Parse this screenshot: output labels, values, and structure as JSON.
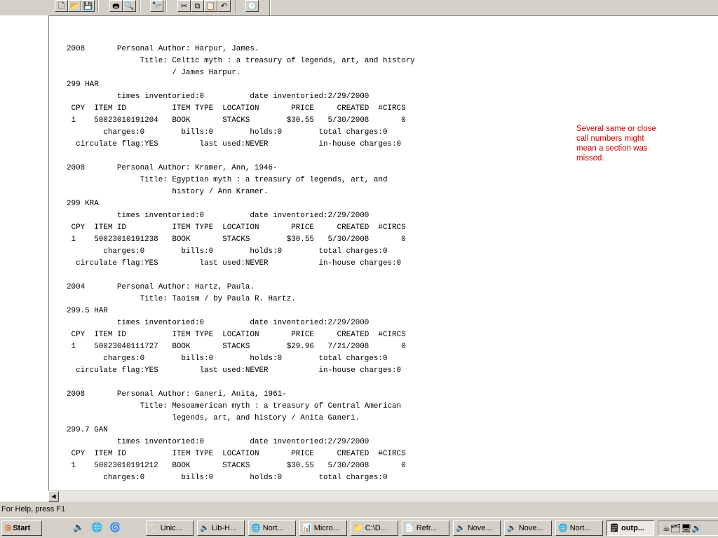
{
  "toolbar": {
    "buttons": [
      {
        "name": "new-icon",
        "glyph": "🗋"
      },
      {
        "name": "open-icon",
        "glyph": "📂"
      },
      {
        "name": "save-icon",
        "glyph": "💾"
      },
      {
        "name": "print-icon",
        "glyph": "🖶"
      },
      {
        "name": "print-preview-icon",
        "glyph": "🔍"
      },
      {
        "name": "find-icon",
        "glyph": "🔭"
      },
      {
        "name": "cut-icon",
        "glyph": "✂"
      },
      {
        "name": "copy-icon",
        "glyph": "⧉"
      },
      {
        "name": "paste-icon",
        "glyph": "📋"
      },
      {
        "name": "undo-icon",
        "glyph": "↶"
      },
      {
        "name": "date-time-icon",
        "glyph": "🕒"
      }
    ]
  },
  "document": {
    "text": "2008       Personal Author: Harpur, James.\n                Title: Celtic myth : a treasury of legends, art, and history\n                       / James Harpur.\n299 HAR\n           times inventoried:0          date inventoried:2/29/2000\n CPY  ITEM ID          ITEM TYPE  LOCATION       PRICE     CREATED  #CIRCS\n 1    50023010191204   BOOK       STACKS        $30.55   5/30/2008       0\n        charges:0        bills:0        holds:0        total charges:0\n  circulate flag:YES         last used:NEVER           in-house charges:0\n\n2008       Personal Author: Kramer, Ann, 1946-\n                Title: Egyptian myth : a treasury of legends, art, and\n                       history / Ann Kramer.\n299 KRA\n           times inventoried:0          date inventoried:2/29/2000\n CPY  ITEM ID          ITEM TYPE  LOCATION       PRICE     CREATED  #CIRCS\n 1    50023010191238   BOOK       STACKS        $30.55   5/30/2008       0\n        charges:0        bills:0        holds:0        total charges:0\n  circulate flag:YES         last used:NEVER           in-house charges:0\n\n2004       Personal Author: Hartz, Paula.\n                Title: Taoism / by Paula R. Hartz.\n299.5 HAR\n           times inventoried:0          date inventoried:2/29/2000\n CPY  ITEM ID          ITEM TYPE  LOCATION       PRICE     CREATED  #CIRCS\n 1    50023040111727   BOOK       STACKS        $29.96   7/21/2008       0\n        charges:0        bills:0        holds:0        total charges:0\n  circulate flag:YES         last used:NEVER           in-house charges:0\n\n2008       Personal Author: Ganeri, Anita, 1961-\n                Title: Mesoamerican myth : a treasury of Central American\n                       legends, art, and history / Anita Ganeri.\n299.7 GAN\n           times inventoried:0          date inventoried:2/29/2000\n CPY  ITEM ID          ITEM TYPE  LOCATION       PRICE     CREATED  #CIRCS\n 1    50023010191212   BOOK       STACKS        $30.55   5/30/2008       0\n        charges:0        bills:0        holds:0        total charges:0"
  },
  "annotation": {
    "text": "Several  same or close call numbers might mean a section was  missed.",
    "color": "#d00000"
  },
  "statusbar": {
    "text": "For Help, press F1"
  },
  "taskbar": {
    "start_label": "Start",
    "quick_launch": [
      {
        "name": "quick-launch-app-icon",
        "glyph": "🔈"
      },
      {
        "name": "internet-explorer-icon",
        "glyph": "🌐"
      },
      {
        "name": "quick-launch-browser-icon",
        "glyph": "🌀"
      }
    ],
    "tasks": [
      {
        "label": "Unic...",
        "glyph": "🍸",
        "active": false
      },
      {
        "label": "Lib-H...",
        "glyph": "🔈",
        "active": false
      },
      {
        "label": "Nort...",
        "glyph": "🌐",
        "active": false
      },
      {
        "label": "Micro...",
        "glyph": "📊",
        "active": false
      },
      {
        "label": "C:\\D...",
        "glyph": "📁",
        "active": false
      },
      {
        "label": "Refr...",
        "glyph": "📄",
        "active": false
      },
      {
        "label": "Nove...",
        "glyph": "🔈",
        "active": false
      },
      {
        "label": "Nove...",
        "glyph": "🔈",
        "active": false
      },
      {
        "label": "Nort...",
        "glyph": "🌐",
        "active": false
      },
      {
        "label": "outp...",
        "glyph": "🗒",
        "active": true
      }
    ],
    "tray_glyphs": "☕🗂🖥🔊"
  }
}
